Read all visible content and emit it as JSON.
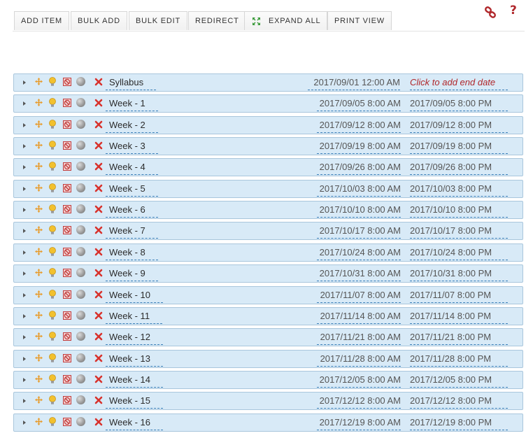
{
  "toolbar": {
    "buttons": [
      {
        "label": "ADD ITEM"
      },
      {
        "label": "BULK ADD"
      },
      {
        "label": "BULK EDIT"
      },
      {
        "label": "REDIRECT"
      },
      {
        "label": "EXPAND ALL"
      },
      {
        "label": "PRINT VIEW"
      }
    ],
    "help_label": "?"
  },
  "items": [
    {
      "title": "Syllabus",
      "start": "2017/09/01 12:00 AM",
      "end": "Click to add end date",
      "end_placeholder": true
    },
    {
      "title": "Week - 1",
      "start": "2017/09/05 8:00 AM",
      "end": "2017/09/05 8:00 PM"
    },
    {
      "title": "Week - 2",
      "start": "2017/09/12 8:00 AM",
      "end": "2017/09/12 8:00 PM"
    },
    {
      "title": "Week - 3",
      "start": "2017/09/19 8:00 AM",
      "end": "2017/09/19 8:00 PM"
    },
    {
      "title": "Week - 4",
      "start": "2017/09/26 8:00 AM",
      "end": "2017/09/26 8:00 PM"
    },
    {
      "title": "Week - 5",
      "start": "2017/10/03 8:00 AM",
      "end": "2017/10/03 8:00 PM"
    },
    {
      "title": "Week - 6",
      "start": "2017/10/10 8:00 AM",
      "end": "2017/10/10 8:00 PM"
    },
    {
      "title": "Week - 7",
      "start": "2017/10/17 8:00 AM",
      "end": "2017/10/17 8:00 PM"
    },
    {
      "title": "Week - 8",
      "start": "2017/10/24 8:00 AM",
      "end": "2017/10/24 8:00 PM"
    },
    {
      "title": "Week - 9",
      "start": "2017/10/31 8:00 AM",
      "end": "2017/10/31 8:00 PM"
    },
    {
      "title": "Week - 10",
      "start": "2017/11/07 8:00 AM",
      "end": "2017/11/07 8:00 PM"
    },
    {
      "title": "Week - 11",
      "start": "2017/11/14 8:00 AM",
      "end": "2017/11/14 8:00 PM"
    },
    {
      "title": "Week - 12",
      "start": "2017/11/21 8:00 AM",
      "end": "2017/11/21 8:00 PM"
    },
    {
      "title": "Week - 13",
      "start": "2017/11/28 8:00 AM",
      "end": "2017/11/28 8:00 PM"
    },
    {
      "title": "Week - 14",
      "start": "2017/12/05 8:00 AM",
      "end": "2017/12/05 8:00 PM"
    },
    {
      "title": "Week - 15",
      "start": "2017/12/12 8:00 AM",
      "end": "2017/12/12 8:00 PM"
    },
    {
      "title": "Week - 16",
      "start": "2017/12/19 8:00 AM",
      "end": "2017/12/19 8:00 PM"
    }
  ],
  "icons": {
    "row": [
      "expand-caret-icon",
      "move-icon",
      "lightbulb-icon",
      "hide-icon",
      "status-dot-icon",
      "delete-icon"
    ],
    "top": [
      "link-icon",
      "help-icon"
    ]
  },
  "colors": {
    "row_background": "#d8eaf7",
    "row_border": "#a9c6dc",
    "dashed_underline": "#3b7fb8",
    "placeholder_text": "#b0272b",
    "delete_icon": "#d8322c",
    "move_icon": "#e89c2c",
    "bulb_icon": "#f2c12e"
  }
}
